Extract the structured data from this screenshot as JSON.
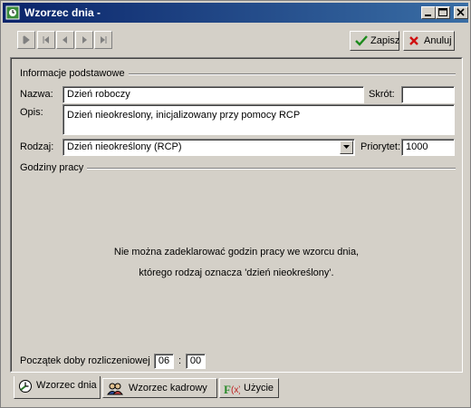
{
  "window": {
    "title": "Wzorzec dnia -"
  },
  "toolbar": {
    "save_label": "Zapisz",
    "cancel_label": "Anuluj",
    "nav_icons": [
      "first-record-icon",
      "prev-page-icon",
      "prev-record-icon",
      "next-record-icon",
      "last-record-icon"
    ]
  },
  "basic_info": {
    "title": "Informacje podstawowe",
    "name_label": "Nazwa:",
    "name_value": "Dzień roboczy",
    "short_label": "Skrót:",
    "short_value": "",
    "desc_label": "Opis:",
    "desc_value": "Dzień nieokreslony, inicjalizowany przy pomocy RCP",
    "type_label": "Rodzaj:",
    "type_value": "Dzień nieokreślony (RCP)",
    "priority_label": "Priorytet:",
    "priority_value": "1000"
  },
  "work_hours": {
    "title": "Godziny pracy",
    "message_line1": "Nie można zadeklarować godzin pracy we wzorcu dnia,",
    "message_line2": "którego rodzaj oznacza 'dzień nieokreślony'."
  },
  "day_start": {
    "label": "Początek doby rozliczeniowej",
    "hours": "06",
    "separator": ":",
    "minutes": "00"
  },
  "tabs": [
    {
      "label": "Wzorzec dnia",
      "icon": "clock-icon",
      "active": true
    },
    {
      "label": "Wzorzec kadrowy",
      "icon": "people-icon",
      "active": false
    },
    {
      "label": "Użycie",
      "icon": "function-icon",
      "active": false
    }
  ],
  "colors": {
    "titlebar_start": "#0a246a",
    "titlebar_end": "#3a6ea5",
    "face": "#d4d0c8"
  }
}
